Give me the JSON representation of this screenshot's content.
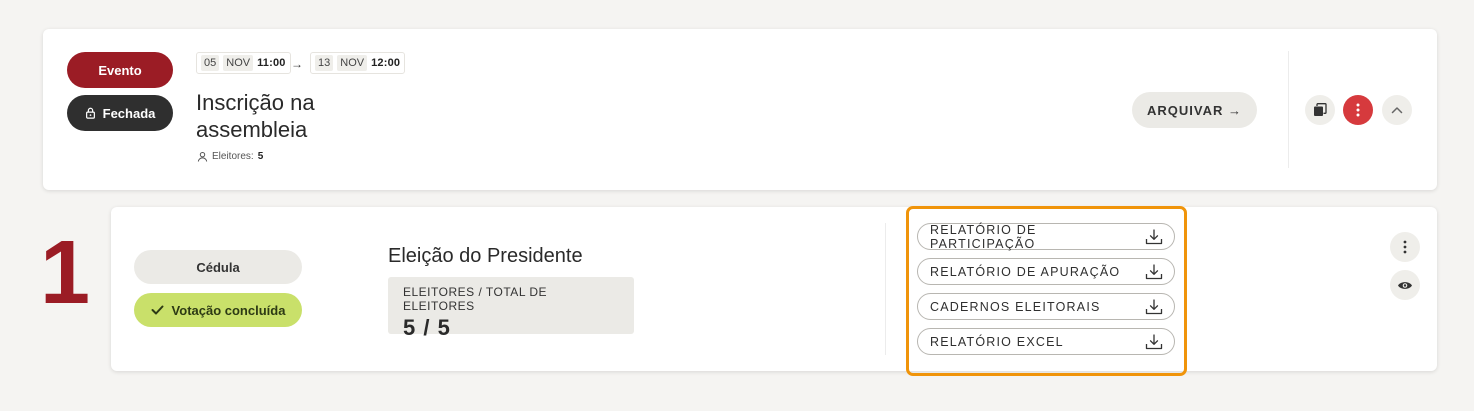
{
  "event": {
    "type_badge": "Evento",
    "state_badge": "Fechada",
    "start": {
      "day": "05",
      "month": "NOV",
      "time": "11:00"
    },
    "end": {
      "day": "13",
      "month": "NOV",
      "time": "12:00"
    },
    "arrow": "→",
    "title": "Inscrição na assembleia",
    "voters_label": "Eleitores:",
    "voters_count": "5",
    "archive_label": "ARQUIVAR →",
    "colors": {
      "brand": "#9b1c25",
      "dark": "#2f2f2f",
      "menu": "#d63a3d"
    },
    "icons": [
      "lock-icon",
      "user-icon",
      "copy-icon",
      "vertical-dots-icon",
      "chevron-up-icon"
    ]
  },
  "ballot": {
    "number": "1",
    "label": "Cédula",
    "status": "Votação concluída",
    "title": "Eleição do Presidente",
    "stats_label": "ELEITORES / TOTAL DE ELEITORES",
    "stats_value": "5 / 5",
    "reports": [
      {
        "label": "RELATÓRIO DE PARTICIPAÇÃO"
      },
      {
        "label": "RELATÓRIO DE APURAÇÃO"
      },
      {
        "label": "CADERNOS ELEITORAIS"
      },
      {
        "label": "RELATÓRIO EXCEL"
      }
    ],
    "colors": {
      "status": "#c9e06a",
      "highlight": "#f0940a"
    },
    "icons": [
      "check-icon",
      "download-icon",
      "vertical-dots-icon",
      "eye-icon"
    ]
  }
}
